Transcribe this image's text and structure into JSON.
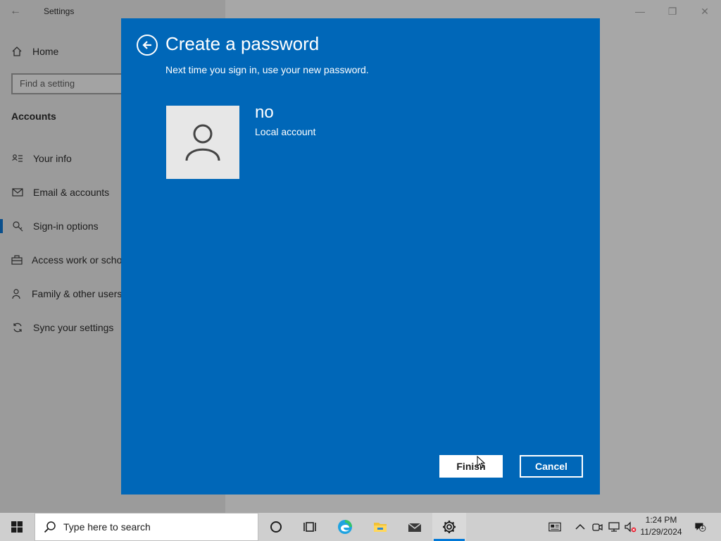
{
  "settings": {
    "window_title": "Settings",
    "home_label": "Home",
    "search_placeholder": "Find a setting",
    "section_heading": "Accounts",
    "nav_items": [
      {
        "label": "Your info",
        "icon": "person-card-icon"
      },
      {
        "label": "Email & accounts",
        "icon": "mail-icon"
      },
      {
        "label": "Sign-in options",
        "icon": "key-icon",
        "selected": true
      },
      {
        "label": "Access work or school",
        "icon": "briefcase-icon"
      },
      {
        "label": "Family & other users",
        "icon": "add-person-icon"
      },
      {
        "label": "Sync your settings",
        "icon": "sync-icon"
      }
    ]
  },
  "dialog": {
    "title": "Create a password",
    "subtitle": "Next time you sign in, use your new password.",
    "account_name": "no",
    "account_type": "Local account",
    "finish_label": "Finish",
    "cancel_label": "Cancel",
    "background_color": "#0067b8"
  },
  "taskbar": {
    "search_placeholder": "Type here to search",
    "time": "1:24 PM",
    "date": "11/29/2024",
    "notification_count": "1",
    "accent_color": "#0078d7"
  }
}
